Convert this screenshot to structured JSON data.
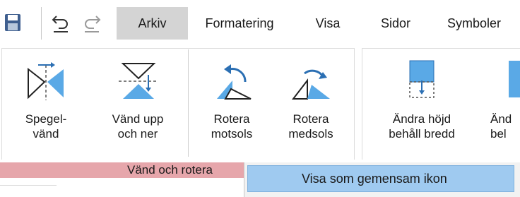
{
  "quick_access": [
    {
      "name": "save-icon"
    },
    {
      "name": "undo-icon"
    },
    {
      "name": "redo-icon"
    }
  ],
  "tabs": [
    "Arkiv",
    "Formatering",
    "Visa",
    "Sidor",
    "Symboler"
  ],
  "active_tab": "Arkiv",
  "ribbon": {
    "buttons": [
      {
        "line1": "Spegel-",
        "line2": "vänd",
        "icon": "mirror-flip-icon"
      },
      {
        "line1": "Vänd upp",
        "line2": "och ner",
        "icon": "flip-vertical-icon"
      },
      {
        "line1": "Rotera",
        "line2": "motsols",
        "icon": "rotate-ccw-icon"
      },
      {
        "line1": "Rotera",
        "line2": "medsols",
        "icon": "rotate-cw-icon"
      },
      {
        "line1": "Ändra höjd",
        "line2": "behåll bredd",
        "icon": "change-height-icon"
      },
      {
        "line1": "Änd",
        "line2": "bel",
        "icon": "change-width-icon"
      }
    ],
    "group_label": "Vänd och rotera"
  },
  "context_menu": {
    "item": "Visa som gemensam ikon"
  },
  "colors": {
    "accent_blue": "#5aa9e6",
    "group_label_bg": "#e6a6ab",
    "menu_highlight": "#9fcaf0",
    "active_tab_bg": "#d4d4d4"
  }
}
